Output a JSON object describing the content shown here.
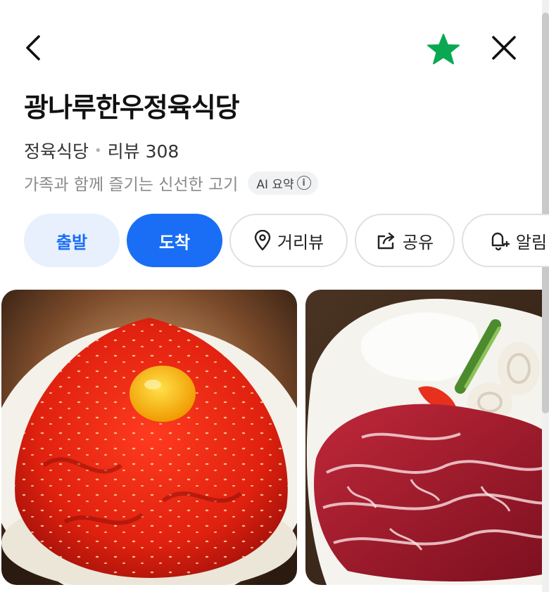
{
  "header": {
    "back_icon": "chevron-left-icon",
    "favorite_icon": "star-icon",
    "favorite_color": "#0aa852",
    "close_icon": "close-icon"
  },
  "place": {
    "name": "광나루한우정육식당",
    "category": "정육식당",
    "review_label": "리뷰 308",
    "summary": "가족과 함께 즐기는 신선한 고기",
    "ai_badge": "AI 요약"
  },
  "actions": {
    "start": "출발",
    "arrive": "도착",
    "street_view": "거리뷰",
    "share": "공유",
    "alert": "알림"
  },
  "colors": {
    "accent": "#1a6ef5",
    "accent_light": "#e8f0fd"
  },
  "photos": [
    {
      "subject": "beef tartare (yukhoe) with egg yolk"
    },
    {
      "subject": "sliced marbled raw beef on white plate"
    }
  ]
}
